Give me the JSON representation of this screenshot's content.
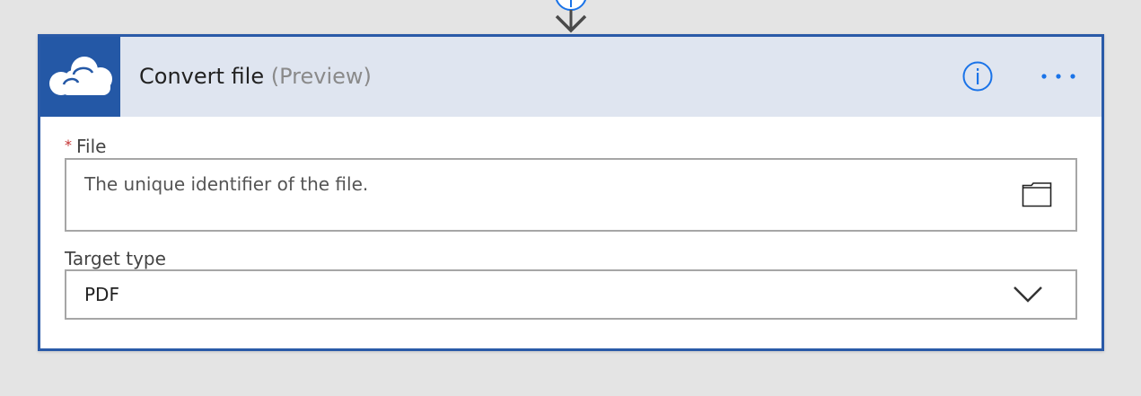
{
  "card": {
    "title": "Convert file",
    "title_suffix": "(Preview)",
    "connector_icon": "onedrive-cloud-icon",
    "accent_color": "#2458a6",
    "header_bg": "#dfe5f0"
  },
  "fields": {
    "file": {
      "required_mark": "*",
      "label": "File",
      "placeholder": "The unique identifier of the file.",
      "picker_icon": "folder-icon"
    },
    "target_type": {
      "label": "Target type",
      "value": "PDF",
      "dropdown_icon": "chevron-down-icon"
    }
  },
  "header_actions": {
    "info_icon": "info-icon",
    "more_icon": "ellipsis-icon",
    "icon_color": "#1a73e8"
  }
}
